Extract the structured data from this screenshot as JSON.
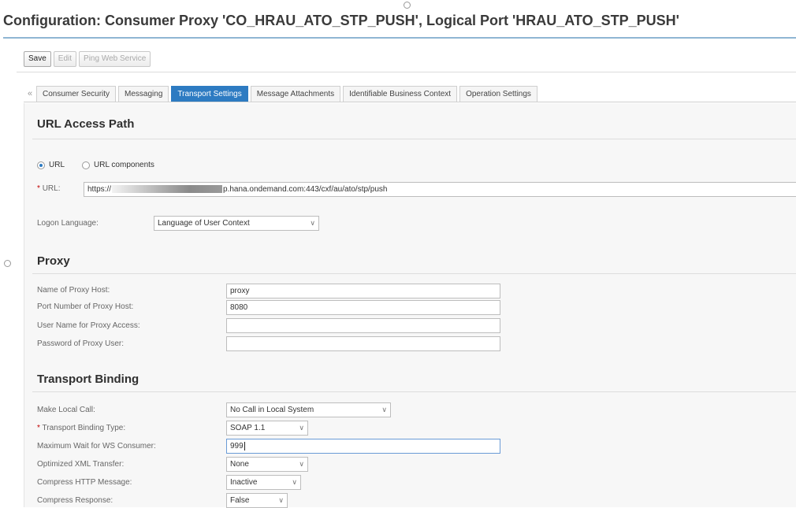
{
  "window": {
    "title": "Configuration: Consumer Proxy 'CO_HRAU_ATO_STP_PUSH', Logical Port 'HRAU_ATO_STP_PUSH'"
  },
  "toolbar": {
    "save_label": "Save",
    "edit_label": "Edit",
    "ping_label": "Ping Web Service"
  },
  "tabs": {
    "scroll_left_glyph": "«",
    "items": [
      {
        "label": "Consumer Security"
      },
      {
        "label": "Messaging"
      },
      {
        "label": "Transport Settings",
        "active": true
      },
      {
        "label": "Message Attachments"
      },
      {
        "label": "Identifiable Business Context"
      },
      {
        "label": "Operation Settings"
      }
    ]
  },
  "url_access": {
    "title": "URL Access Path",
    "radio_url_label": "URL",
    "radio_components_label": "URL components",
    "selected": "URL",
    "url_label": "URL:",
    "url_prefix": "https://",
    "url_suffix": "p.hana.ondemand.com:443/cxf/au/ato/stp/push",
    "logon_language_label": "Logon Language:",
    "logon_language_value": "Language of User Context"
  },
  "proxy": {
    "title": "Proxy",
    "host_label": "Name of Proxy Host:",
    "host_value": "proxy",
    "port_label": "Port Number of Proxy Host:",
    "port_value": "8080",
    "user_label": "User Name for Proxy Access:",
    "user_value": "",
    "password_label": "Password of Proxy User:",
    "password_value": ""
  },
  "transport_binding": {
    "title": "Transport Binding",
    "local_call_label": "Make Local Call:",
    "local_call_value": "No Call in Local System",
    "binding_type_label": "Transport Binding Type:",
    "binding_type_value": "SOAP 1.1",
    "max_wait_label": "Maximum Wait for WS Consumer:",
    "max_wait_value": "999",
    "xml_transfer_label": "Optimized XML Transfer:",
    "xml_transfer_value": "None",
    "compress_http_label": "Compress HTTP Message:",
    "compress_http_value": "Inactive",
    "compress_response_label": "Compress Response:",
    "compress_response_value": "False"
  },
  "colors": {
    "accent": "#2d7bc2",
    "required": "#c00000"
  }
}
